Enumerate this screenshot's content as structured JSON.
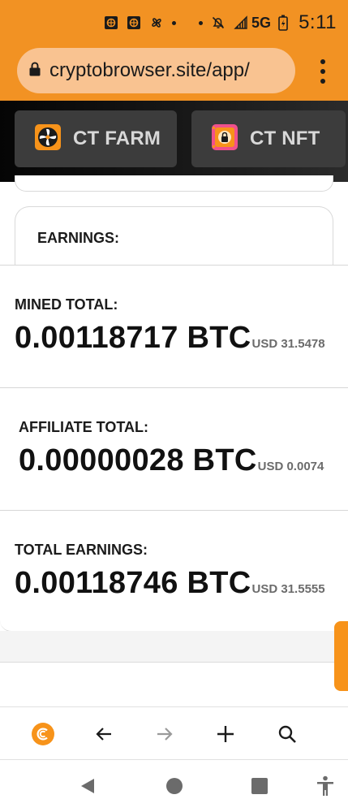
{
  "status_bar": {
    "time": "5:11",
    "network": "5G",
    "icons": [
      "app-notification-icon",
      "app-notification-icon",
      "pinwheel-icon",
      "dot-icon",
      "dot-icon",
      "muted-bell-icon",
      "signal-icon",
      "battery-charging-icon"
    ]
  },
  "browser": {
    "url": "cryptobrowser.site/app/",
    "icons": {
      "lock": "lock-icon",
      "menu": "more-vert-icon"
    }
  },
  "header_tabs": [
    {
      "label": "CT FARM",
      "icon": "fan-farm-icon"
    },
    {
      "label": "CT NFT",
      "icon": "nft-lock-icon"
    }
  ],
  "earnings": {
    "title": "EARNINGS:",
    "rows": [
      {
        "label": "MINED TOTAL:",
        "btc": "0.00118717 BTC",
        "usd": "USD 31.5478"
      },
      {
        "label": "AFFILIATE TOTAL:",
        "btc": "0.00000028 BTC",
        "usd": "USD 0.0074"
      },
      {
        "label": "TOTAL EARNINGS:",
        "btc": "0.00118746 BTC",
        "usd": "USD 31.5555"
      }
    ]
  },
  "toolbar": {
    "icons": [
      "cryptotab-logo-icon",
      "back-arrow-icon",
      "forward-arrow-icon",
      "new-tab-plus-icon",
      "search-icon"
    ]
  },
  "system_nav": {
    "icons": [
      "back-triangle-icon",
      "home-circle-icon",
      "recents-square-icon",
      "accessibility-icon"
    ]
  },
  "colors": {
    "accent": "#f29223",
    "header_dark": "#0a0a0a",
    "card_border": "#d9d9d9",
    "usd_grey": "#6b6b6b",
    "forward_disabled": "#9a9a9a"
  }
}
